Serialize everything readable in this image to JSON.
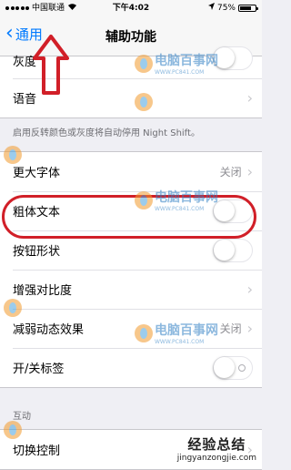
{
  "status_bar": {
    "carrier": "中国联通",
    "time": "下午4:02",
    "battery": "75%",
    "battery_level": 0.75
  },
  "nav": {
    "back_label": "通用",
    "title": "辅助功能"
  },
  "group1": {
    "rows": [
      {
        "label": "灰度"
      },
      {
        "label": "语音"
      }
    ]
  },
  "group1_footer": "启用反转颜色或灰度将自动停用 Night Shift。",
  "group2": {
    "rows": [
      {
        "label": "更大字体",
        "value": "关闭"
      },
      {
        "label": "粗体文本"
      },
      {
        "label": "按钮形状"
      },
      {
        "label": "增强对比度"
      },
      {
        "label": "减弱动态效果",
        "value": "关闭"
      },
      {
        "label": "开/关标签"
      }
    ]
  },
  "section_interaction": {
    "header": "互动",
    "rows": [
      {
        "label": "切换控制"
      }
    ]
  },
  "watermarks": {
    "site": "电脑百事网",
    "site_sub": "WWW.PC841.COM",
    "brand": "经验总结",
    "brand_url": "jingyanzongjie.com"
  },
  "colors": {
    "accent": "#007aff",
    "annotation": "#d11f28",
    "background": "#efeff4"
  }
}
